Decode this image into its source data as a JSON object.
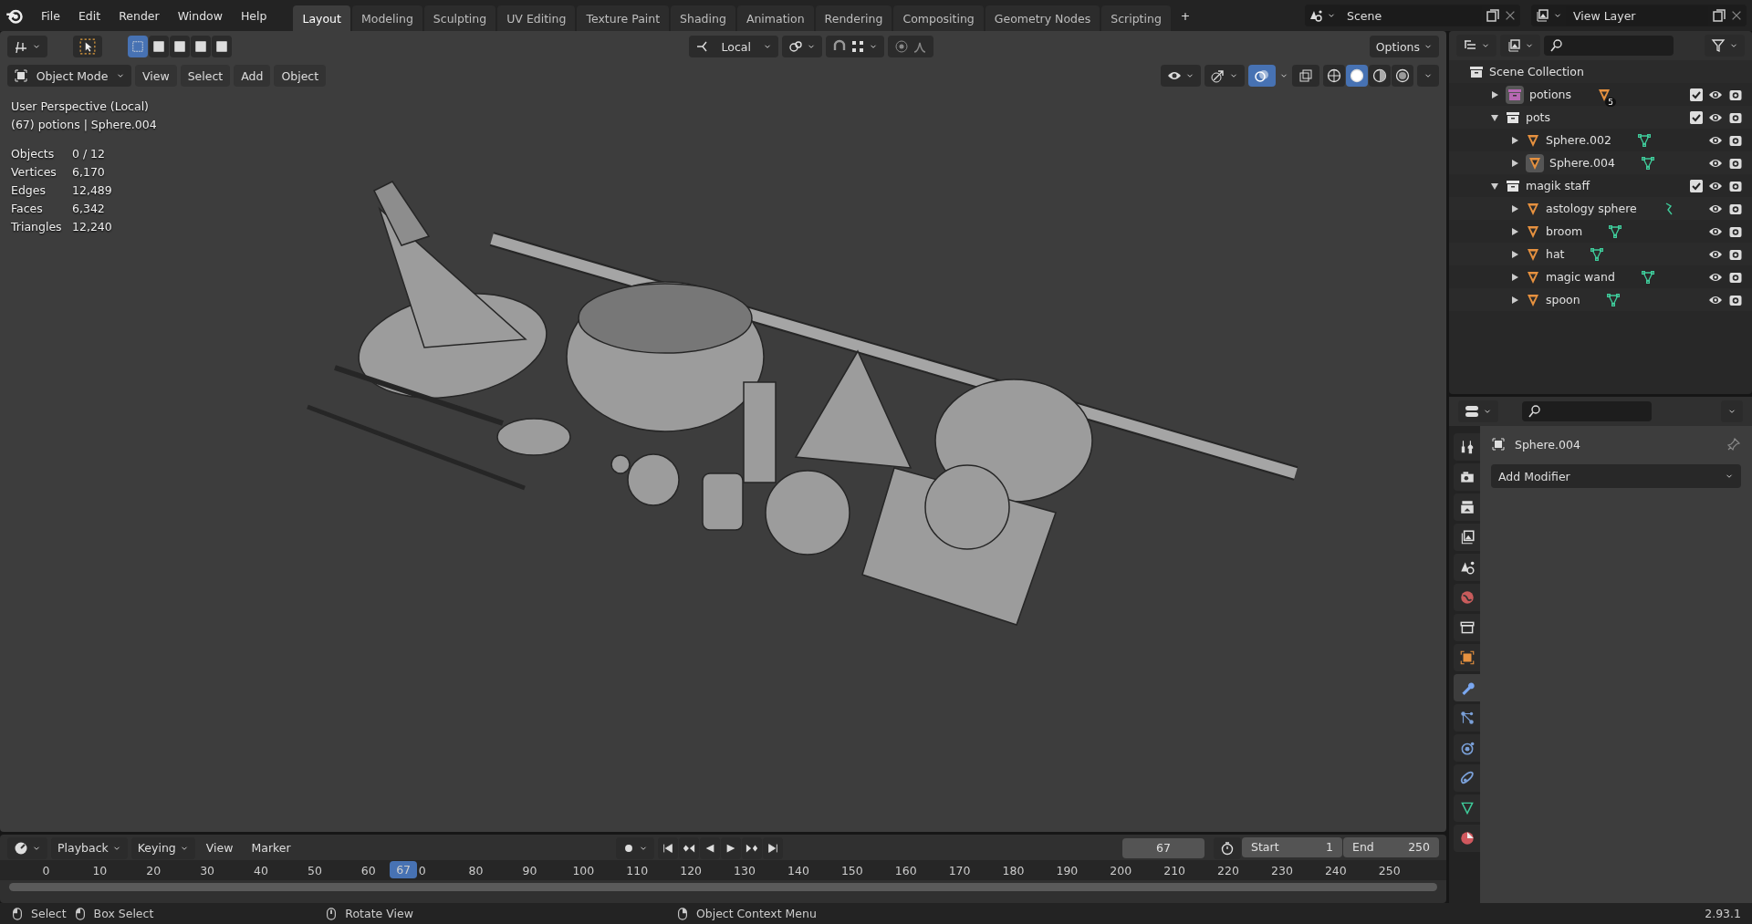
{
  "menu": [
    "File",
    "Edit",
    "Render",
    "Window",
    "Help"
  ],
  "workspaces": [
    {
      "label": "Layout",
      "selected": true
    },
    {
      "label": "Modeling",
      "selected": false
    },
    {
      "label": "Sculpting",
      "selected": false
    },
    {
      "label": "UV Editing",
      "selected": false
    },
    {
      "label": "Texture Paint",
      "selected": false
    },
    {
      "label": "Shading",
      "selected": false
    },
    {
      "label": "Animation",
      "selected": false
    },
    {
      "label": "Rendering",
      "selected": false
    },
    {
      "label": "Compositing",
      "selected": false
    },
    {
      "label": "Geometry Nodes",
      "selected": false
    },
    {
      "label": "Scripting",
      "selected": false
    }
  ],
  "add_workspace": "+",
  "scene": "Scene",
  "view_layer": "View Layer",
  "viewport": {
    "select_modes": [
      {
        "selected": true
      },
      {
        "selected": false
      },
      {
        "selected": false
      },
      {
        "selected": false
      },
      {
        "selected": false
      }
    ],
    "orientation": "Local",
    "options": "Options",
    "mode": "Object Mode",
    "menus": [
      "View",
      "Select",
      "Add",
      "Object"
    ],
    "shading": [
      {
        "kind": "wireframe",
        "selected": false
      },
      {
        "kind": "solid",
        "selected": true
      },
      {
        "kind": "material",
        "selected": false
      },
      {
        "kind": "rendered",
        "selected": false
      }
    ],
    "perspective": "User Perspective (Local)",
    "context": "(67) potions | Sphere.004",
    "stats": [
      {
        "label": "Objects",
        "value": "0 / 12"
      },
      {
        "label": "Vertices",
        "value": "6,170"
      },
      {
        "label": "Edges",
        "value": "12,489"
      },
      {
        "label": "Faces",
        "value": "6,342"
      },
      {
        "label": "Triangles",
        "value": "12,240"
      }
    ]
  },
  "outliner": {
    "label": "Scene Collection",
    "children": [
      {
        "label": "potions",
        "kind": "collection",
        "color": "#b868b4",
        "expanded": false,
        "checked": true,
        "badge": "5"
      },
      {
        "label": "pots",
        "kind": "collection",
        "color": "#e4e4e4",
        "expanded": true,
        "checked": true,
        "children": [
          {
            "label": "Sphere.002",
            "kind": "mesh",
            "active": false
          },
          {
            "label": "Sphere.004",
            "kind": "mesh",
            "active": true
          }
        ]
      },
      {
        "label": "magik staff",
        "kind": "collection",
        "color": "#e4e4e4",
        "expanded": true,
        "checked": true,
        "children": [
          {
            "label": "astology sphere",
            "kind": "curve",
            "active": false
          },
          {
            "label": "broom",
            "kind": "mesh",
            "active": false
          },
          {
            "label": "hat",
            "kind": "mesh",
            "active": false
          },
          {
            "label": "magic wand",
            "kind": "mesh",
            "active": false
          },
          {
            "label": "spoon",
            "kind": "mesh",
            "active": false
          }
        ]
      }
    ]
  },
  "properties": {
    "tabs": [
      {
        "kind": "tool",
        "selected": false
      },
      {
        "kind": "render",
        "selected": false
      },
      {
        "kind": "output",
        "selected": false
      },
      {
        "kind": "view_layer",
        "selected": false
      },
      {
        "kind": "scene",
        "selected": false
      },
      {
        "kind": "world",
        "selected": false
      },
      {
        "kind": "collection",
        "selected": false
      },
      {
        "kind": "object",
        "selected": false
      },
      {
        "kind": "modifiers",
        "selected": true
      },
      {
        "kind": "particles",
        "selected": false
      },
      {
        "kind": "physics",
        "selected": false
      },
      {
        "kind": "constraints",
        "selected": false
      },
      {
        "kind": "data",
        "selected": false
      },
      {
        "kind": "material",
        "selected": false
      }
    ],
    "object": "Sphere.004",
    "add_modifier": "Add Modifier"
  },
  "timeline": {
    "menus": [
      "Playback",
      "Keying",
      "View",
      "Marker"
    ],
    "frame": "67",
    "playhead": "67",
    "start_label": "Start",
    "start": "1",
    "end_label": "End",
    "end": "250",
    "ruler": [
      "0",
      "10",
      "20",
      "30",
      "40",
      "50",
      "60",
      "0",
      "80",
      "90",
      "100",
      "110",
      "120",
      "130",
      "140",
      "150",
      "160",
      "170",
      "180",
      "190",
      "200",
      "210",
      "220",
      "230",
      "240",
      "250"
    ]
  },
  "status": [
    {
      "kind": "left",
      "label": "Select"
    },
    {
      "kind": "drag",
      "label": "Box Select"
    },
    {
      "kind": "middle",
      "label": "Rotate View"
    },
    {
      "kind": "right",
      "label": "Object Context Menu"
    }
  ],
  "version": "2.93.1"
}
